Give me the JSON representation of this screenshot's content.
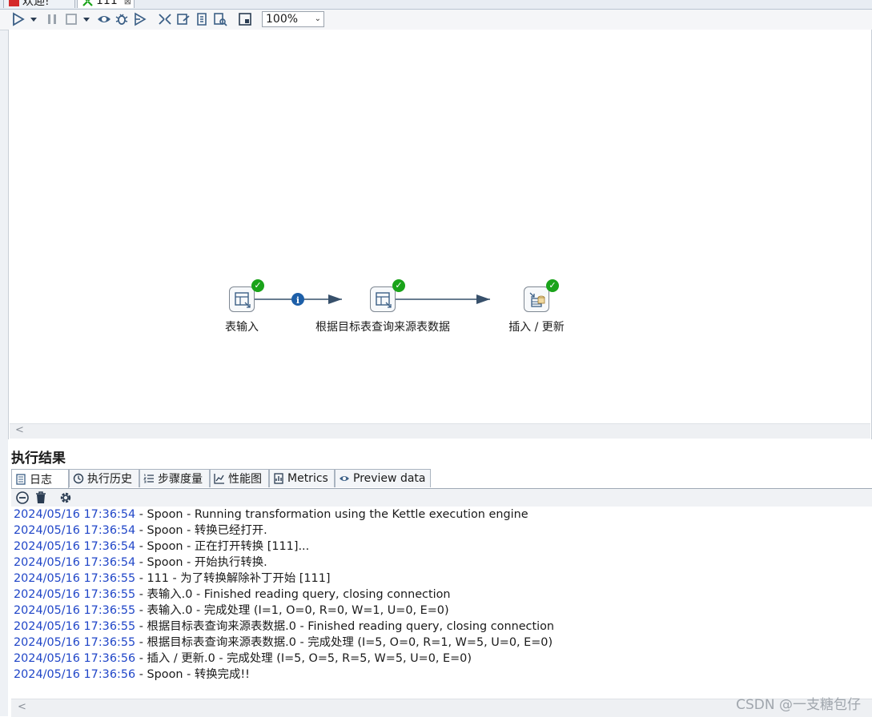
{
  "doc_tabs": [
    {
      "label": "欢迎!",
      "icon": "spoon-icon"
    },
    {
      "label": "111",
      "icon": "transformation-icon",
      "close": "⊠"
    }
  ],
  "toolbar": {
    "buttons": [
      "run-icon",
      "run-options-dropdown-icon",
      "pause-icon",
      "stop-icon",
      "stop-dropdown-icon",
      "preview-icon",
      "debug-icon",
      "replay-icon",
      "verify-icon",
      "impact-icon",
      "sql-icon",
      "explore-db-icon",
      "show-results-icon"
    ],
    "zoom": "100%"
  },
  "canvas": {
    "steps": [
      {
        "label": "表输入",
        "status": "✓"
      },
      {
        "label": "根据目标表查询来源表数据",
        "status": "✓"
      },
      {
        "label": "插入 / 更新",
        "status": "✓"
      }
    ],
    "hop_info_icon": "i",
    "scroll_left": "<"
  },
  "results": {
    "title": "执行结果",
    "tabs": [
      "日志",
      "执行历史",
      "步骤度量",
      "性能图",
      "Metrics",
      "Preview data"
    ],
    "active_tab": "日志",
    "log_tools": [
      "clear-log-icon",
      "trash-icon",
      "settings-icon"
    ],
    "log": [
      {
        "ts": "2024/05/16 17:36:54",
        "msg": " - Spoon - Running transformation using the Kettle execution engine"
      },
      {
        "ts": "2024/05/16 17:36:54",
        "msg": " - Spoon - 转换已经打开."
      },
      {
        "ts": "2024/05/16 17:36:54",
        "msg": " - Spoon - 正在打开转换 [111]..."
      },
      {
        "ts": "2024/05/16 17:36:54",
        "msg": " - Spoon - 开始执行转换."
      },
      {
        "ts": "2024/05/16 17:36:55",
        "msg": " - 111 - 为了转换解除补丁开始  [111]"
      },
      {
        "ts": "2024/05/16 17:36:55",
        "msg": " - 表输入.0 - Finished reading query, closing connection"
      },
      {
        "ts": "2024/05/16 17:36:55",
        "msg": " - 表输入.0 - 完成处理 (I=1, O=0, R=0, W=1, U=0, E=0)"
      },
      {
        "ts": "2024/05/16 17:36:55",
        "msg": " - 根据目标表查询来源表数据.0 - Finished reading query, closing connection"
      },
      {
        "ts": "2024/05/16 17:36:55",
        "msg": " - 根据目标表查询来源表数据.0 - 完成处理 (I=5, O=0, R=1, W=5, U=0, E=0)"
      },
      {
        "ts": "2024/05/16 17:36:56",
        "msg": " - 插入 / 更新.0 - 完成处理 (I=5, O=5, R=5, W=5, U=0, E=0)"
      },
      {
        "ts": "2024/05/16 17:36:56",
        "msg": " - Spoon - 转换完成!!"
      }
    ],
    "scroll_left": "<"
  },
  "watermark": "CSDN @一支糖包仔",
  "colors": {
    "timestamp": "#2046c8",
    "ok": "#1aa31a",
    "info": "#1d5fa8",
    "hop": "#37506b"
  }
}
